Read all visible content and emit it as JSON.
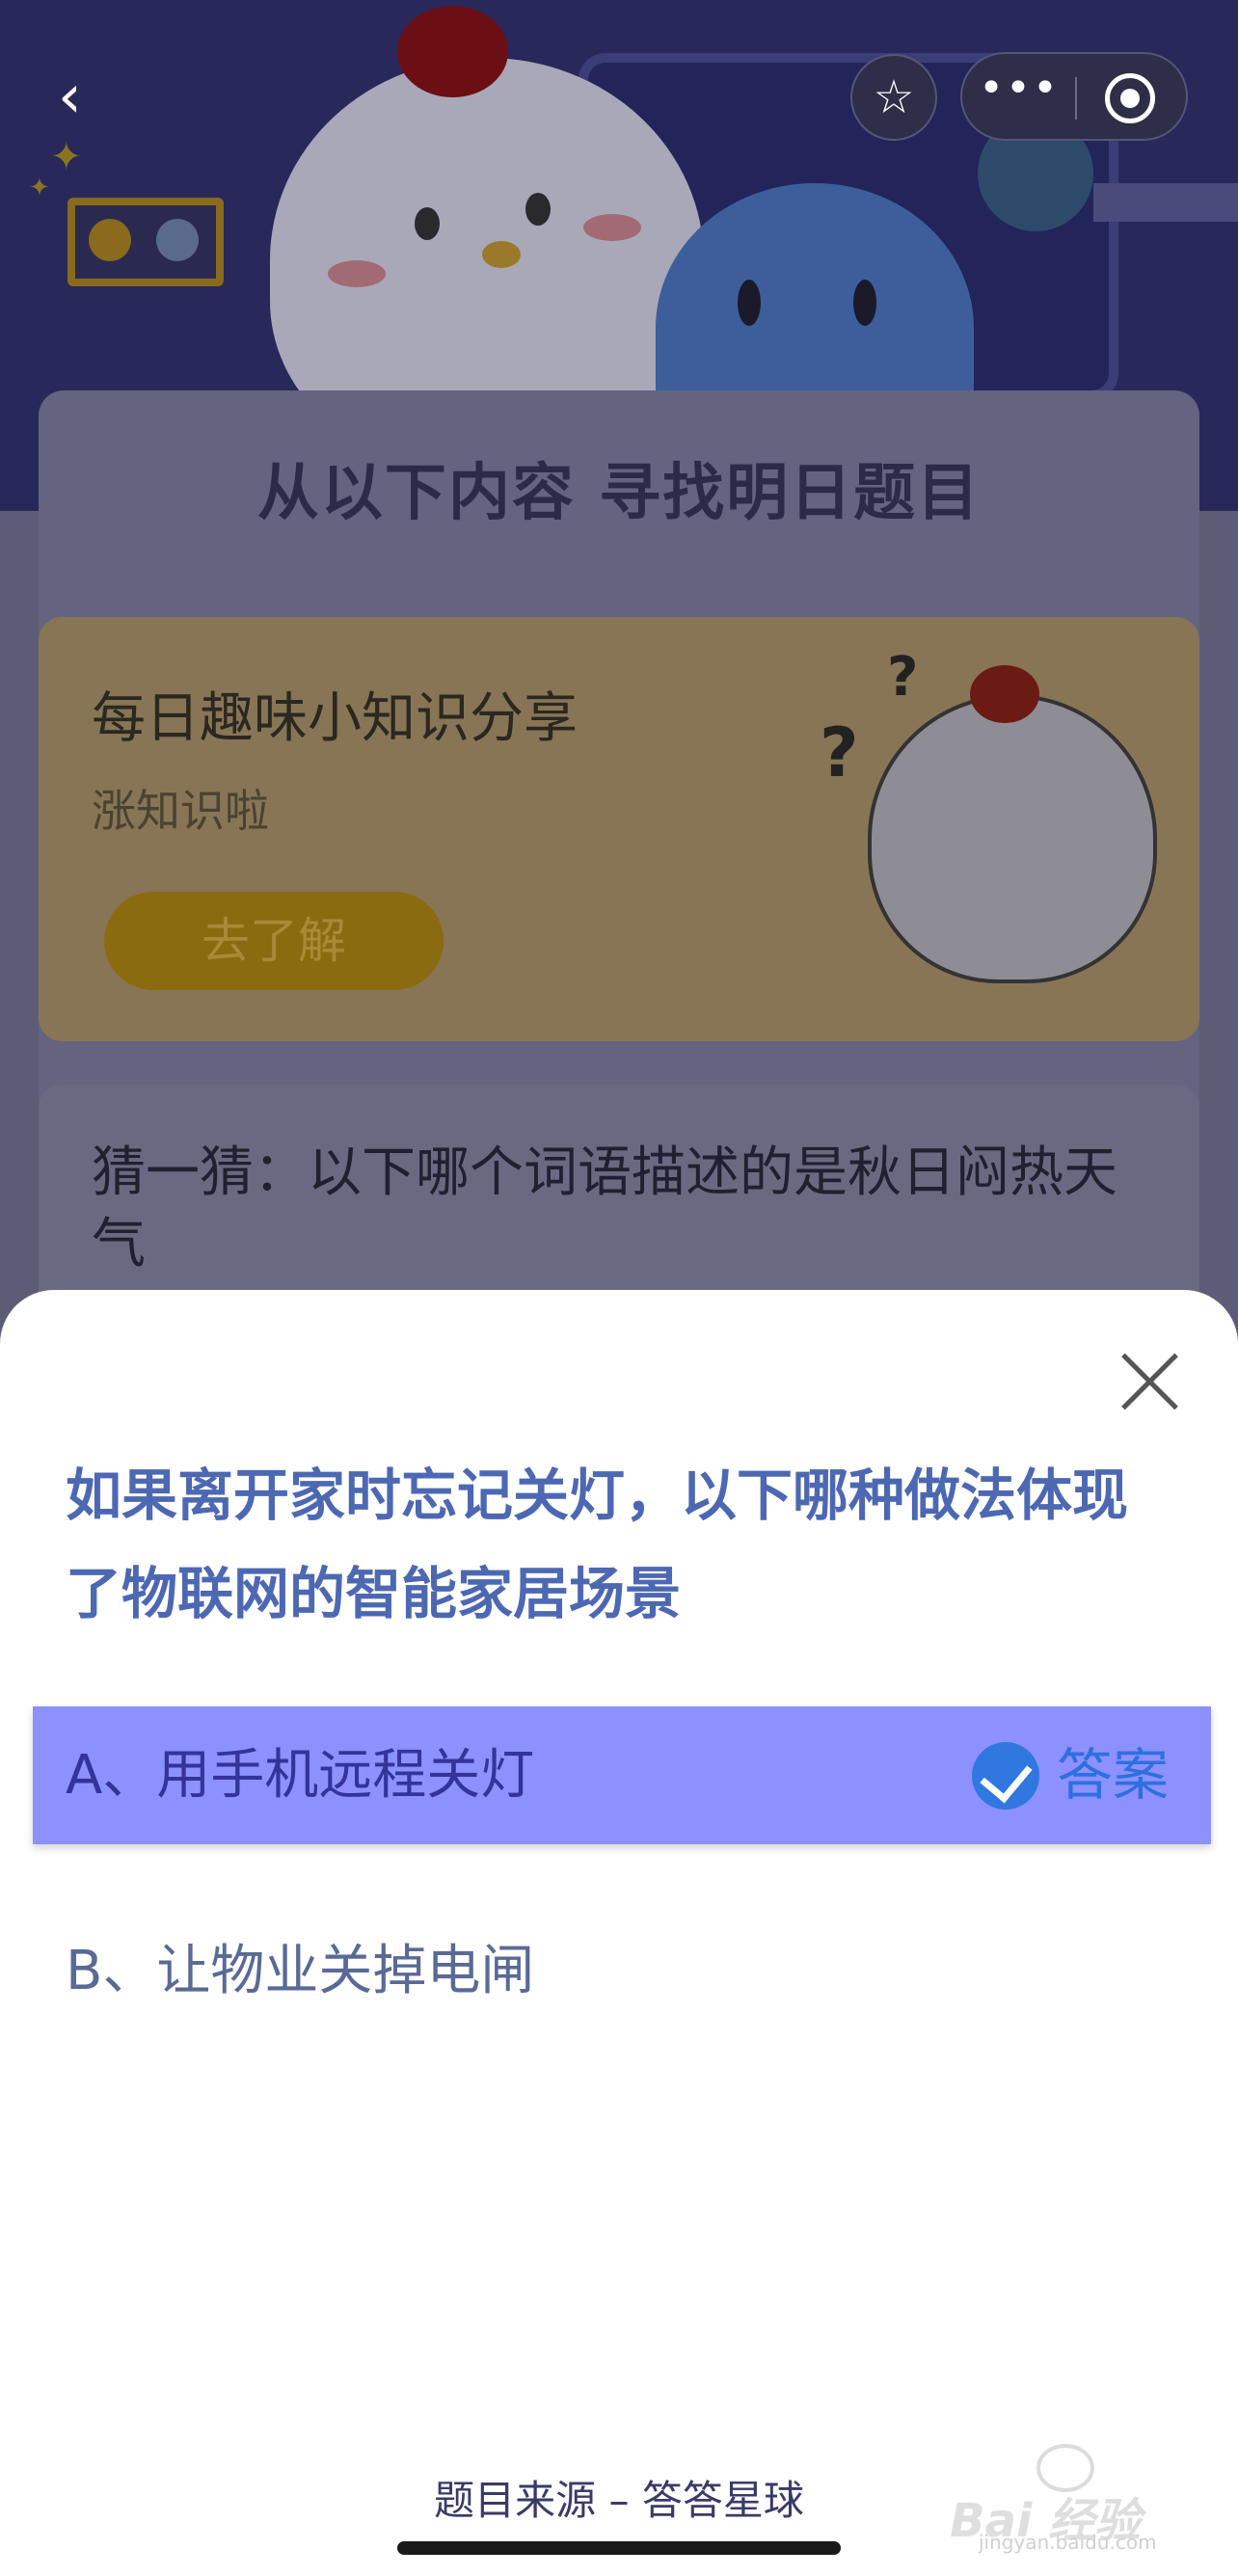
{
  "nav": {
    "back_icon": "chevron-left-icon",
    "favorite_icon": "star-icon",
    "more_icon": "more-dots-icon",
    "more_glyph": "•••",
    "capsule_close_icon": "target-icon"
  },
  "background": {
    "section_title": "从以下内容  寻找明日题目",
    "knowledge_card": {
      "title": "每日趣味小知识分享",
      "subtitle": "涨知识啦",
      "button_label": "去了解"
    },
    "guess_card": {
      "question": "猜一猜：以下哪个词语描述的是秋日闷热天气"
    }
  },
  "sheet": {
    "close_icon": "close-icon",
    "question": "如果离开家时忘记关灯，以下哪种做法体现了物联网的智能家居场景",
    "options": [
      {
        "label": "A、用手机远程关灯",
        "is_answer": true,
        "answer_tag": "答案"
      },
      {
        "label": "B、让物业关掉电闸",
        "is_answer": false
      }
    ],
    "source": "题目来源 – 答答星球"
  },
  "watermark": {
    "text": "Bai 经验",
    "sub": "jingyan.baidu.com"
  },
  "colors": {
    "accent_highlight": "#8c91ff",
    "question_text": "#4d68b3",
    "check_badge": "#3077e0",
    "answer_text": "#2e6fe0",
    "overlay_bg": "#5d5c76"
  }
}
